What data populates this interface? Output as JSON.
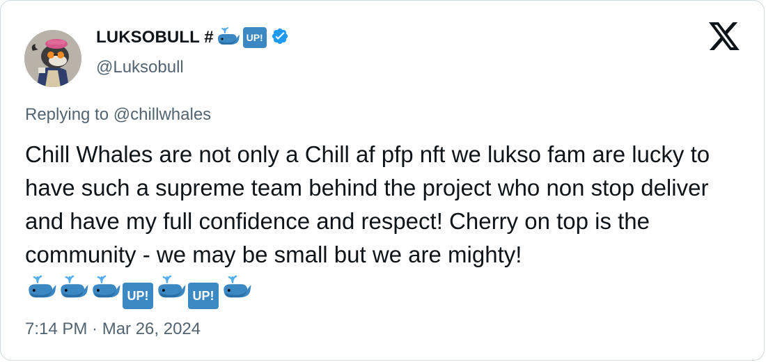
{
  "tweet": {
    "author_name": "LUKSOBULL #",
    "up_badge": "UP!",
    "handle": "@Luksobull",
    "reply_prefix": "Replying to",
    "reply_to": "@chillwhales",
    "text": "Chill Whales are not only a Chill af pfp nft we lukso fam are lucky to have such a supreme team behind the project who non stop deliver and have my full confidence and respect! Cherry on top is the community - we may be small but we are mighty!",
    "trailing_emojis": [
      "spouting-whale",
      "spouting-whale",
      "spouting-whale",
      "up-button",
      "spouting-whale",
      "up-button",
      "spouting-whale"
    ],
    "timestamp": "7:14 PM · Mar 26, 2024"
  },
  "icons": {
    "verified": "verified-badge-icon",
    "platform": "x-logo-icon",
    "whale": "spouting-whale-icon"
  },
  "colors": {
    "verified_blue": "#1d9bf0",
    "up_badge": "#3b88c3",
    "secondary_text": "#536471",
    "primary_text": "#0f1419",
    "border": "#cfd9de"
  }
}
